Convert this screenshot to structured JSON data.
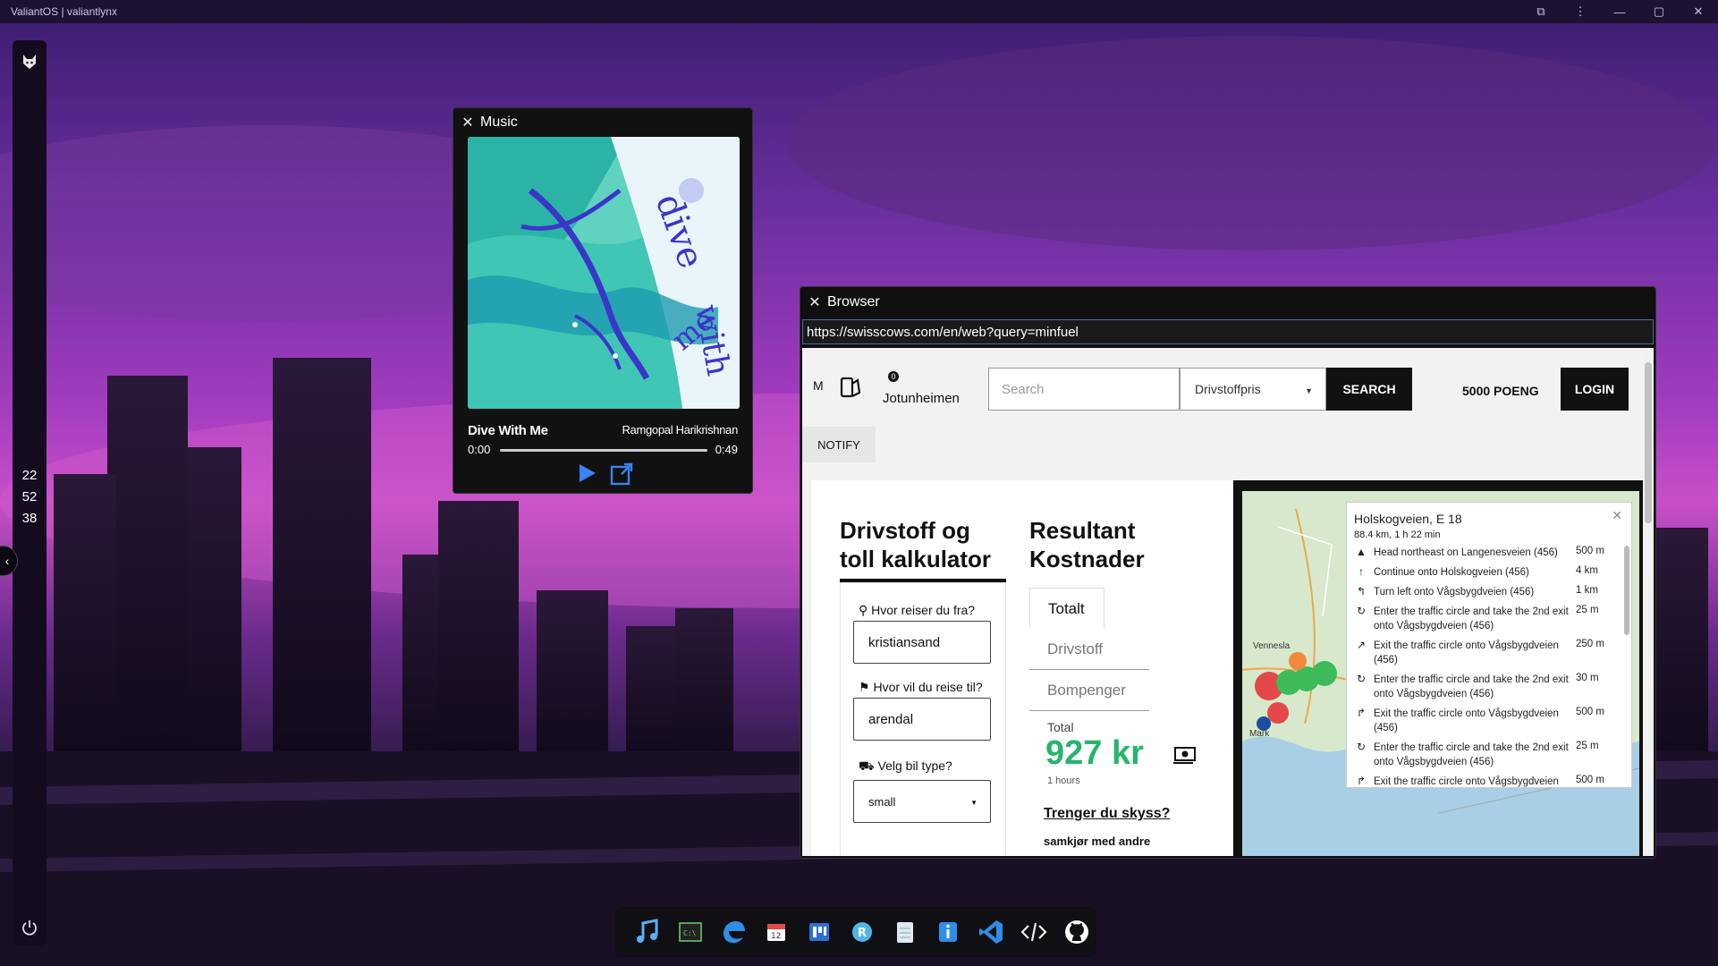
{
  "window": {
    "title": "ValiantOS | valiantlynx"
  },
  "clock": {
    "hours": "22",
    "minutes": "52",
    "seconds": "38"
  },
  "music": {
    "window_title": "Music",
    "track_title": "Dive With Me",
    "artist": "Ramgopal Harikrishnan",
    "time_current": "0:00",
    "time_total": "0:49",
    "progress": 0.0
  },
  "browser": {
    "window_title": "Browser",
    "url": "https://swisscows.com/en/web?query=minfuel",
    "site": {
      "nav": {
        "brand_glyph": "M",
        "badge_count": "0",
        "place": "Jotunheimen",
        "search_placeholder": "Search",
        "select_value": "Drivstoffpris",
        "search_label": "SEARCH",
        "points": "5000 POENG",
        "login_label": "LOGIN",
        "notify_label": "NOTIFY"
      },
      "calculator": {
        "title": "Drivstoff og toll kalkulator",
        "from_label": "Hvor reiser du fra?",
        "from_value": "kristiansand",
        "to_label": "Hvor vil du reise til?",
        "to_value": "arendal",
        "car_label": "Velg bil type?",
        "car_value": "small"
      },
      "results": {
        "title": "Resultant Kostnader",
        "tabs": [
          "Totalt",
          "Drivstoff",
          "Bompenger"
        ],
        "total_label": "Total",
        "total_value": "927 kr",
        "duration": "1 hours",
        "ride_link": "Trenger du skyss?",
        "ride_sub": "samkjør med andre"
      },
      "route": {
        "heading": "Holskogveien, E 18",
        "summary": "88.4 km, 1 h 22 min",
        "steps": [
          {
            "icon": "depart-icon",
            "glyph": "▲",
            "text": "Head northeast on Langenesveien (456)",
            "dist": "500 m"
          },
          {
            "icon": "straight-icon",
            "glyph": "↑",
            "text": "Continue onto Holskogveien (456)",
            "dist": "4 km"
          },
          {
            "icon": "turn-left-icon",
            "glyph": "↰",
            "text": "Turn left onto Vågsbygdveien (456)",
            "dist": "1 km"
          },
          {
            "icon": "roundabout-icon",
            "glyph": "↻",
            "text": "Enter the traffic circle and take the 2nd exit onto Vågsbygdveien (456)",
            "dist": "25 m"
          },
          {
            "icon": "exit-icon",
            "glyph": "↗",
            "text": "Exit the traffic circle onto Vågsbygdveien (456)",
            "dist": "250 m"
          },
          {
            "icon": "roundabout-icon",
            "glyph": "↻",
            "text": "Enter the traffic circle and take the 2nd exit onto Vågsbygdveien (456)",
            "dist": "30 m"
          },
          {
            "icon": "exit-icon",
            "glyph": "↱",
            "text": "Exit the traffic circle onto Vågsbygdveien (456)",
            "dist": "500 m"
          },
          {
            "icon": "roundabout-icon",
            "glyph": "↻",
            "text": "Enter the traffic circle and take the 2nd exit onto Vågsbygdveien (456)",
            "dist": "25 m"
          },
          {
            "icon": "exit-icon",
            "glyph": "↱",
            "text": "Exit the traffic circle onto Vågsbygdveien",
            "dist": "500 m"
          }
        ],
        "map_labels": [
          "Vennesla",
          "Mark"
        ]
      }
    }
  },
  "taskbar": {
    "apps": [
      "music-icon",
      "terminal-icon",
      "edge-icon",
      "calendar-icon",
      "kanban-icon",
      "r-app-icon",
      "notepad-icon",
      "info-icon",
      "vscode-icon",
      "code-icon",
      "github-icon"
    ]
  }
}
